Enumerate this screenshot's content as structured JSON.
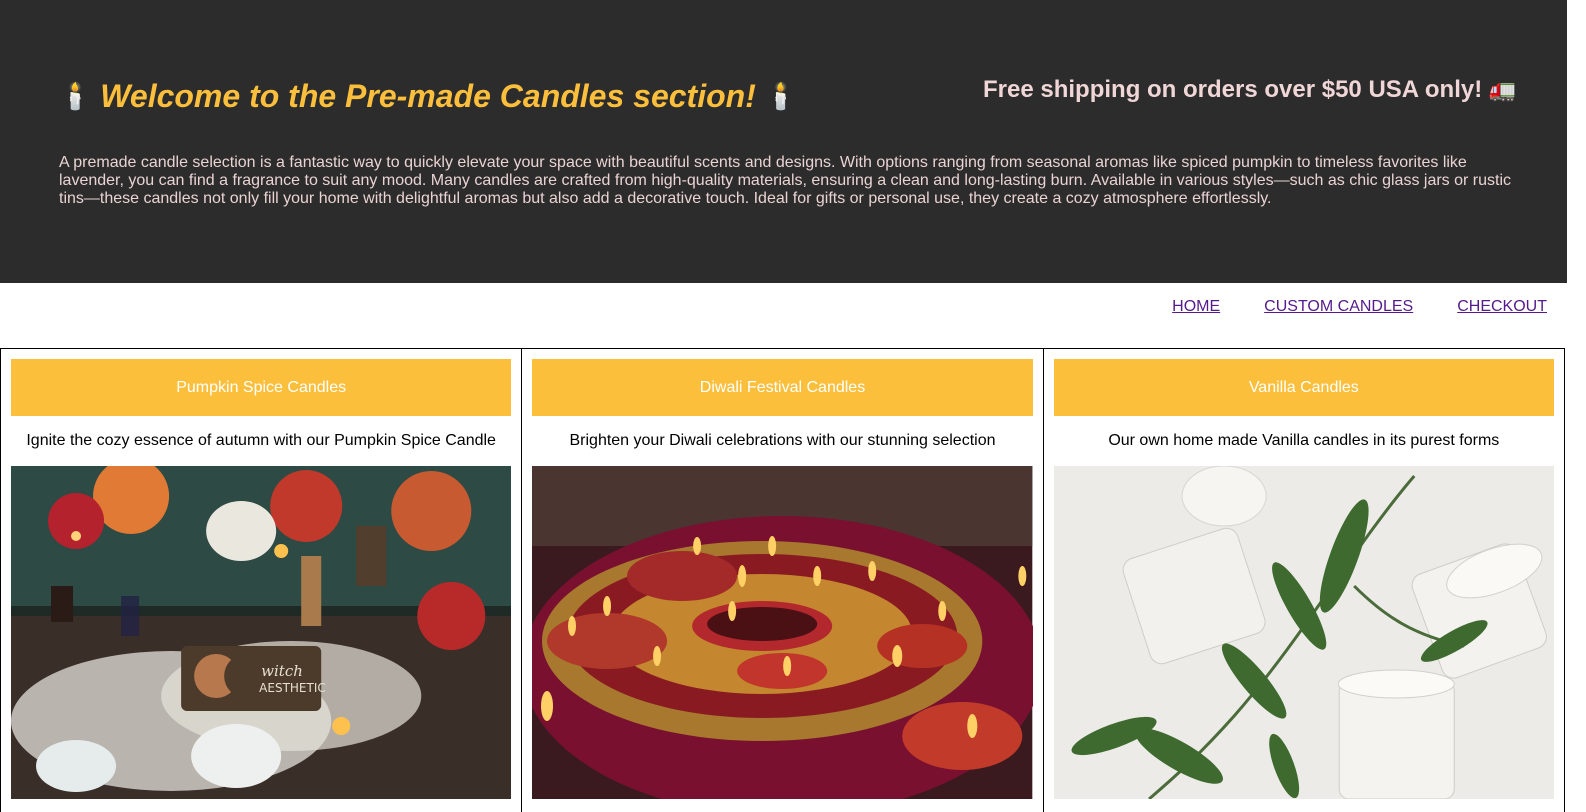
{
  "hero": {
    "candle_glyph": "🕯️",
    "title": "Welcome to the Pre-made Candles section!",
    "shipping": "Free shipping on orders over $50 USA only!",
    "truck_glyph": "🚛",
    "description": "A premade candle selection is a fantastic way to quickly elevate your space with beautiful scents and designs. With options ranging from seasonal aromas like spiced pumpkin to timeless favorites like lavender, you can find a fragrance to suit any mood. Many candles are crafted from high-quality materials, ensuring a clean and long-lasting burn. Available in various styles—such as chic glass jars or rustic tins—these candles not only fill your home with delightful aromas but also add a decorative touch. Ideal for gifts or personal use, they create a cozy atmosphere effortlessly."
  },
  "nav": {
    "home": "HOME",
    "custom": "CUSTOM CANDLES",
    "checkout": "CHECKOUT"
  },
  "cards": [
    {
      "title": "Pumpkin Spice Candles",
      "text": "Ignite the cozy essence of autumn with our Pumpkin Spice Candle"
    },
    {
      "title": "Diwali Festival Candles",
      "text": "Brighten your Diwali celebrations with our stunning selection"
    },
    {
      "title": "Vanilla Candles",
      "text": "Our own home made Vanilla candles in its purest forms"
    }
  ],
  "colors": {
    "hero_bg": "#2c2c2c",
    "accent": "#fcbf3c",
    "link": "#551a8b"
  }
}
